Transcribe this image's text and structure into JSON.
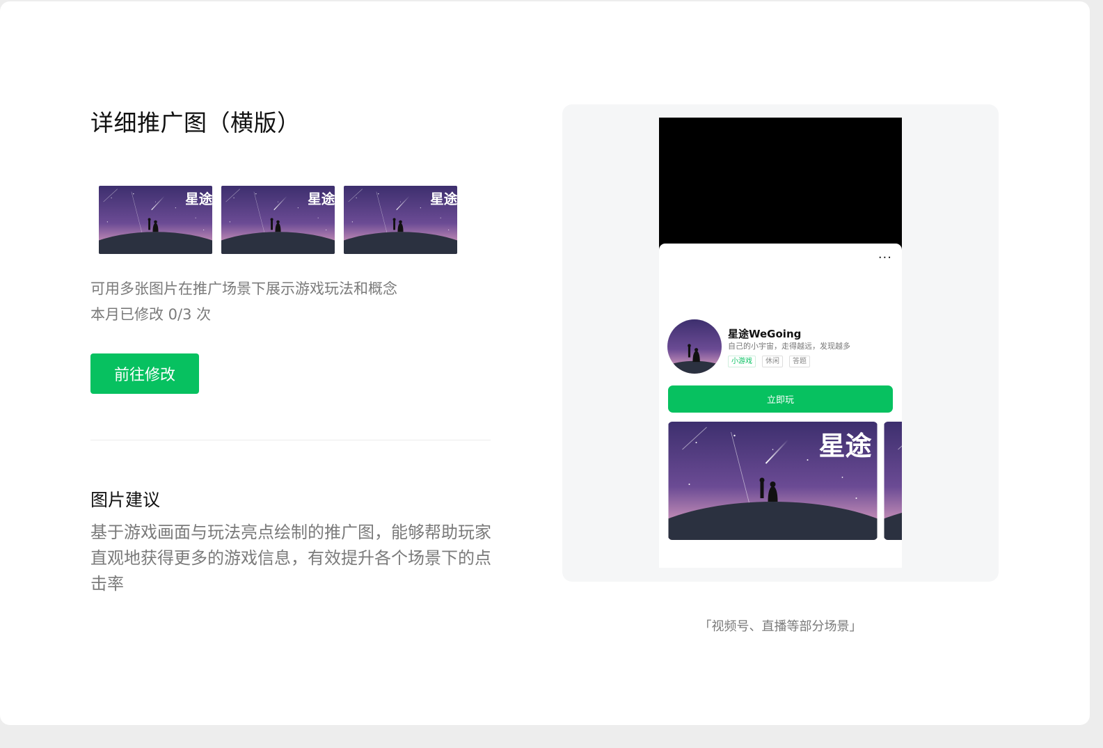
{
  "section": {
    "title": "详细推广图（横版）",
    "thumbnail_logo_text": "星途",
    "thumbnails": [
      "thumb-1",
      "thumb-2",
      "thumb-3"
    ],
    "description": "可用多张图片在推广场景下展示游戏玩法和概念",
    "modify_count": "本月已修改 0/3 次",
    "edit_button": "前往修改"
  },
  "suggestion": {
    "title": "图片建议",
    "text": "基于游戏画面与玩法亮点绘制的推广图，能够帮助玩家直观地获得更多的游戏信息，有效提升各个场景下的点击率"
  },
  "preview": {
    "more_icon": "···",
    "game": {
      "name": "星途WeGoing",
      "slogan": "自己的小宇宙，走得越远，发现越多",
      "tags": [
        "小游戏",
        "休闲",
        "答题"
      ]
    },
    "play_button": "立即玩",
    "screenshot_logo_text": "星途",
    "caption": "「视频号、直播等部分场景」"
  },
  "colors": {
    "accent": "#07c160",
    "sky_top": "#3d2f6e",
    "sky_mid": "#6b4b94",
    "horizon": "#c790b8",
    "planet": "#2b3140"
  }
}
